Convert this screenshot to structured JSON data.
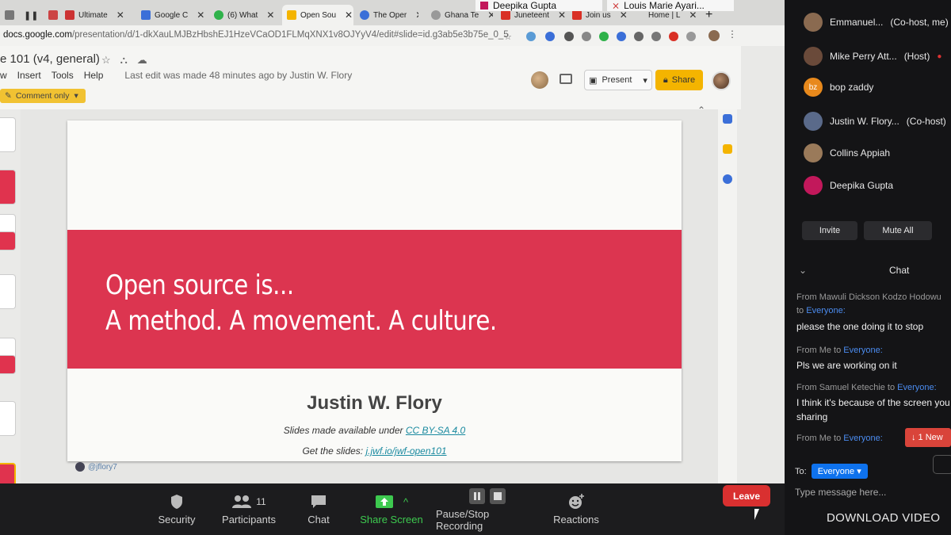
{
  "browser": {
    "tabs": [
      {
        "label": "Ultimate",
        "color": "#cc3333"
      },
      {
        "label": "Google C",
        "color": "#3b6fd8"
      },
      {
        "label": "(6) What",
        "color": "#2fb24a"
      },
      {
        "label": "Open Sou",
        "color": "#f4b400"
      },
      {
        "label": "The Oper",
        "color": "#3b6fd8"
      },
      {
        "label": "Ghana Te",
        "color": "#999999"
      },
      {
        "label": "Juneteent",
        "color": "#d93025"
      },
      {
        "label": "Join us",
        "color": "#d93025"
      },
      {
        "label": "Home | L",
        "color": "#555555"
      }
    ],
    "url_domain": "docs.google.com",
    "url_path": "/presentation/d/1-dkXauLMJBzHbshEJ1HzeVCaOD1FLMqXNX1v8OJYyV4/edit#slide=id.g3ab5e3b75e_0_5"
  },
  "slides_app": {
    "doc_title": "e 101 (v4, general)",
    "menu": [
      "w",
      "Insert",
      "Tools",
      "Help"
    ],
    "last_edit": "Last edit was made 48 minutes ago by Justin W. Flory",
    "comment_only": "Comment only",
    "present_label": "Present",
    "share_label": "Share"
  },
  "slide": {
    "headline_line1": "Open source is...",
    "headline_line2": "A method. A movement. A culture.",
    "author": "Justin W. Flory",
    "license_prefix": "Slides made available under ",
    "license_link": "CC BY-SA 4.0",
    "get_prefix": "Get the slides: ",
    "get_link": "j.jwf.io/jwf-open101",
    "twitter_handle": "@jflory7",
    "banner_color": "#dc3550"
  },
  "video_strip": {
    "label1": "Deepika Gupta",
    "label2": "Louis Marie Ayari..."
  },
  "zoom_toolbar": {
    "security": "Security",
    "participants": "Participants",
    "participants_count": "11",
    "chat": "Chat",
    "share_screen": "Share Screen",
    "recording": "Pause/Stop Recording",
    "reactions": "Reactions",
    "leave": "Leave"
  },
  "participants": [
    {
      "name": "Emmanuel...",
      "role": "(Co-host, me)",
      "initials": "",
      "color": "#8a6a50"
    },
    {
      "name": "Mike Perry Att...",
      "role": "(Host)",
      "initials": "",
      "color": "#6a4a3a"
    },
    {
      "name": "bop zaddy",
      "role": "",
      "initials": "bz",
      "color": "#e8891c"
    },
    {
      "name": "Justin W. Flory...",
      "role": "(Co-host)",
      "initials": "",
      "color": "#5a6a8a"
    },
    {
      "name": "Collins Appiah",
      "role": "",
      "initials": "",
      "color": "#9a7a5a"
    },
    {
      "name": "Deepika Gupta",
      "role": "",
      "initials": "",
      "color": "#c2185b"
    }
  ],
  "panel_buttons": {
    "invite": "Invite",
    "mute_all": "Mute All"
  },
  "chat": {
    "header": "Chat",
    "messages": [
      {
        "from": "From Mawuli Dickson Kodzo Hodowu",
        "to": "to Everyone:",
        "text": [
          "please the one doing it to stop"
        ]
      },
      {
        "from": "From Me to ",
        "to": "Everyone:",
        "text": [
          "Pls we are working on it"
        ]
      },
      {
        "from": "From Samuel Ketechie to ",
        "to": "Everyone:",
        "text": [
          "I think it's because of the screen you",
          "sharing"
        ]
      },
      {
        "from": "From Me to ",
        "to": "Everyone:",
        "text": []
      }
    ],
    "new_badge": "↓ 1 New",
    "to_label": "To:",
    "to_value": "Everyone ▾",
    "input_placeholder": "Type message here..."
  },
  "download_label": "DOWNLOAD VIDEO"
}
